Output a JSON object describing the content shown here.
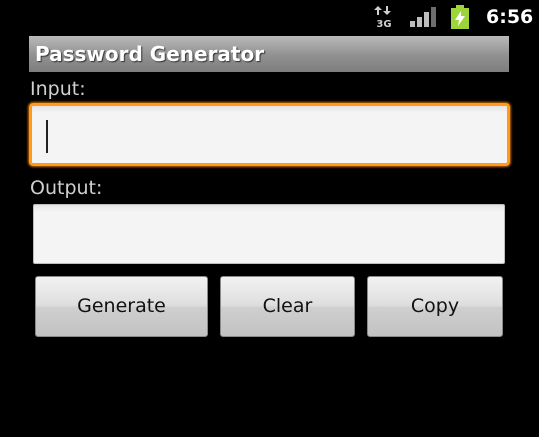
{
  "status_bar": {
    "network_type": "3G",
    "network_icon": "data-3g-icon",
    "signal_icon": "signal-strength-icon",
    "battery_icon": "battery-charging-icon",
    "time": "6:56"
  },
  "app": {
    "title": "Password Generator"
  },
  "form": {
    "input_label": "Input:",
    "input_value": "",
    "output_label": "Output:",
    "output_value": ""
  },
  "buttons": {
    "generate": "Generate",
    "clear": "Clear",
    "copy": "Copy"
  },
  "colors": {
    "background": "#000000",
    "focus_accent": "#ff9a1a",
    "battery_green": "#9bd53a",
    "title_bar": "#909090"
  }
}
